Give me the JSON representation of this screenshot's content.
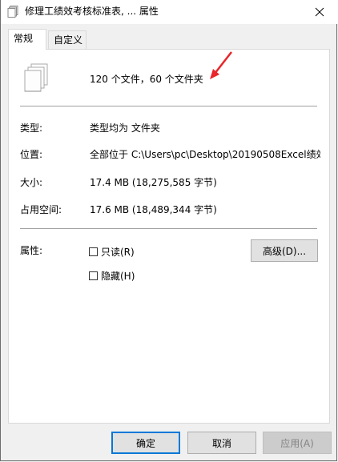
{
  "window": {
    "title": "修理工绩效考核标准表, ... 属性"
  },
  "tabs": [
    {
      "label": "常规",
      "active": true
    },
    {
      "label": "自定义",
      "active": false
    }
  ],
  "general": {
    "summary": "120 个文件，60 个文件夹",
    "rows": [
      {
        "label": "类型:",
        "value": "类型均为 文件夹"
      },
      {
        "label": "位置:",
        "value": "全部位于 C:\\Users\\pc\\Desktop\\20190508Excel绩效"
      },
      {
        "label": "大小:",
        "value": "17.4 MB (18,275,585 字节)"
      },
      {
        "label": "占用空间:",
        "value": "17.6 MB (18,489,344 字节)"
      }
    ],
    "attributes_label": "属性:",
    "readonly_label": "只读(R)",
    "hidden_label": "隐藏(H)",
    "advanced_button": "高级(D)..."
  },
  "footer": {
    "ok": "确定",
    "cancel": "取消",
    "apply": "应用(A)"
  },
  "colors": {
    "accent": "#0078d7",
    "annotation_arrow": "#e8262b"
  },
  "icons": {
    "title": "files-icon",
    "close": "close-icon",
    "summary": "multiple-files-icon",
    "annotation": "red-arrow-icon"
  }
}
